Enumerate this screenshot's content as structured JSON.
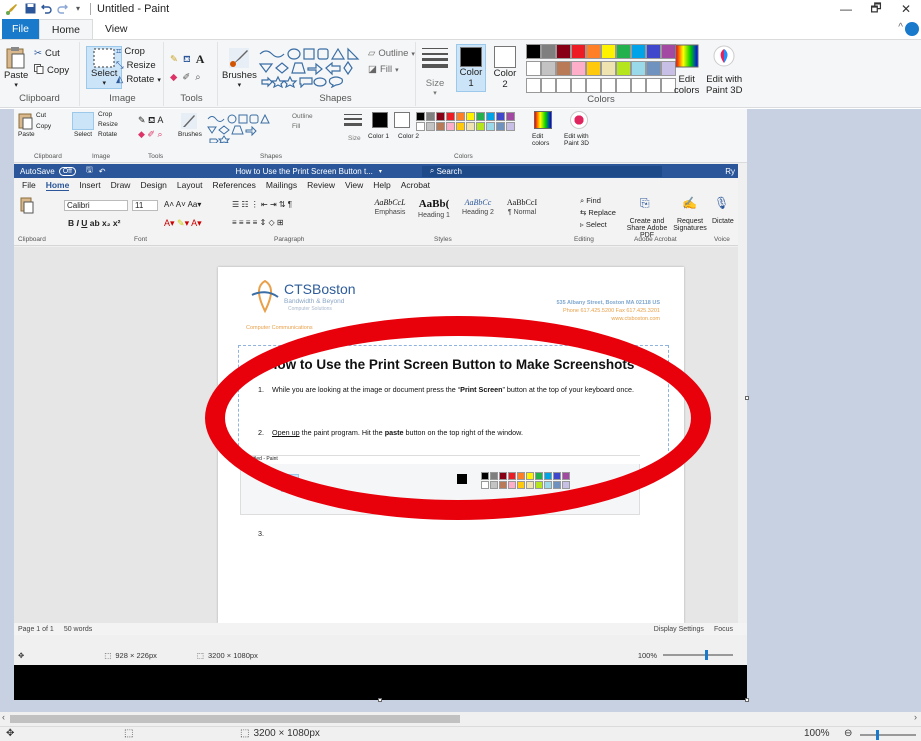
{
  "window": {
    "title": "Untitled - Paint",
    "controls": {
      "minimize": "—",
      "maximize": "🗗",
      "close": "✕"
    }
  },
  "tabs": [
    {
      "label": "File"
    },
    {
      "label": "Home"
    },
    {
      "label": "View"
    }
  ],
  "ribbon": {
    "clipboard": {
      "paste": "Paste",
      "cut": "Cut",
      "copy": "Copy",
      "group": "Clipboard"
    },
    "image": {
      "select": "Select",
      "crop": "Crop",
      "resize": "Resize",
      "rotate": "Rotate",
      "group": "Image"
    },
    "tools": {
      "group": "Tools"
    },
    "brushes": {
      "label": "Brushes"
    },
    "shapes": {
      "outline": "Outline",
      "fill": "Fill",
      "group": "Shapes"
    },
    "size": {
      "label": "Size"
    },
    "color1": {
      "label": "Color",
      "num": "1"
    },
    "color2": {
      "label": "Color",
      "num": "2"
    },
    "edit_colors": {
      "line1": "Edit",
      "line2": "colors"
    },
    "edit_paint3d": {
      "line1": "Edit with",
      "line2": "Paint 3D"
    },
    "colors_group": "Colors"
  },
  "palette": [
    "#000000",
    "#7f7f7f",
    "#880015",
    "#ed1c24",
    "#ff7f27",
    "#fff200",
    "#22b14c",
    "#00a2e8",
    "#3f48cc",
    "#a349a4",
    "#ffffff",
    "#c3c3c3",
    "#b97a57",
    "#ffaec9",
    "#ffc90e",
    "#efe4b0",
    "#b5e61d",
    "#99d9ea",
    "#7092be",
    "#c8bfe7"
  ],
  "inner_paint": {
    "clipboard": {
      "paste": "Paste",
      "cut": "Cut",
      "copy": "Copy",
      "group": "Clipboard"
    },
    "image": {
      "select": "Select",
      "crop": "Crop",
      "resize": "Resize",
      "rotate": "Rotate",
      "group": "Image"
    },
    "tools_group": "Tools",
    "brushes": "Brushes",
    "outline": "Outline",
    "fill": "Fill",
    "shapes_group": "Shapes",
    "size": "Size",
    "color1": "Color 1",
    "color2": "Color 2",
    "edit_colors": "Edit colors",
    "edit_paint3d": "Edit with Paint 3D",
    "colors_group": "Colors",
    "status_selection": "928 × 226px",
    "status_size": "3200 × 1080px",
    "zoom": "100%"
  },
  "word": {
    "autosave": "AutoSave",
    "autosave_state": "Off",
    "doc_title": "How to Use the Print Screen Button t...",
    "search": "Search",
    "user_initials": "Ry",
    "tabs": [
      "File",
      "Home",
      "Insert",
      "Draw",
      "Design",
      "Layout",
      "References",
      "Mailings",
      "Review",
      "View",
      "Help",
      "Acrobat"
    ],
    "font": "Calibri",
    "font_size": "11",
    "styles": [
      "Emphasis",
      "Heading 1",
      "Heading 2",
      "¶ Normal"
    ],
    "style_samples": [
      "AaBbCcL",
      "AaBb(",
      "AaBbCc",
      "AaBbCcI"
    ],
    "group_labels": [
      "Clipboard",
      "Font",
      "Paragraph",
      "Styles",
      "Editing",
      "Adobe Acrobat",
      "Voice"
    ],
    "editing": [
      "Find",
      "Replace",
      "Select"
    ],
    "acrobat": [
      "Create and Share Adobe PDF",
      "Request Signatures"
    ],
    "dictate": "Dictate",
    "status_page": "Page 1 of 1",
    "status_words": "50 words",
    "display_settings": "Display Settings",
    "focus": "Focus"
  },
  "doc": {
    "logo_name": "CTSBoston",
    "logo_tag1": "Bandwidth & Beyond",
    "logo_tag2": "Computer Solutions",
    "tagline": "Computer Communications",
    "address": "535 Albany Street, Boston MA 02118 US",
    "phone": "Phone 617.425.5200 Fax 617.425.3201",
    "web": "www.ctsboston.com",
    "heading": "How to Use the Print Screen Button to Make Screenshots",
    "step1_a": "While you are looking at the image or document press the “",
    "step1_b": "Print Screen",
    "step1_c": "” button at the top of your keyboard once.",
    "step2_a": "Open up",
    "step2_b": " the paint program.  Hit the ",
    "step2_c": "paste",
    "step2_d": " button on the top right of the window.",
    "step3": "3."
  },
  "status": {
    "selection": "",
    "size": "3200 × 1080px",
    "zoom": "100%"
  }
}
